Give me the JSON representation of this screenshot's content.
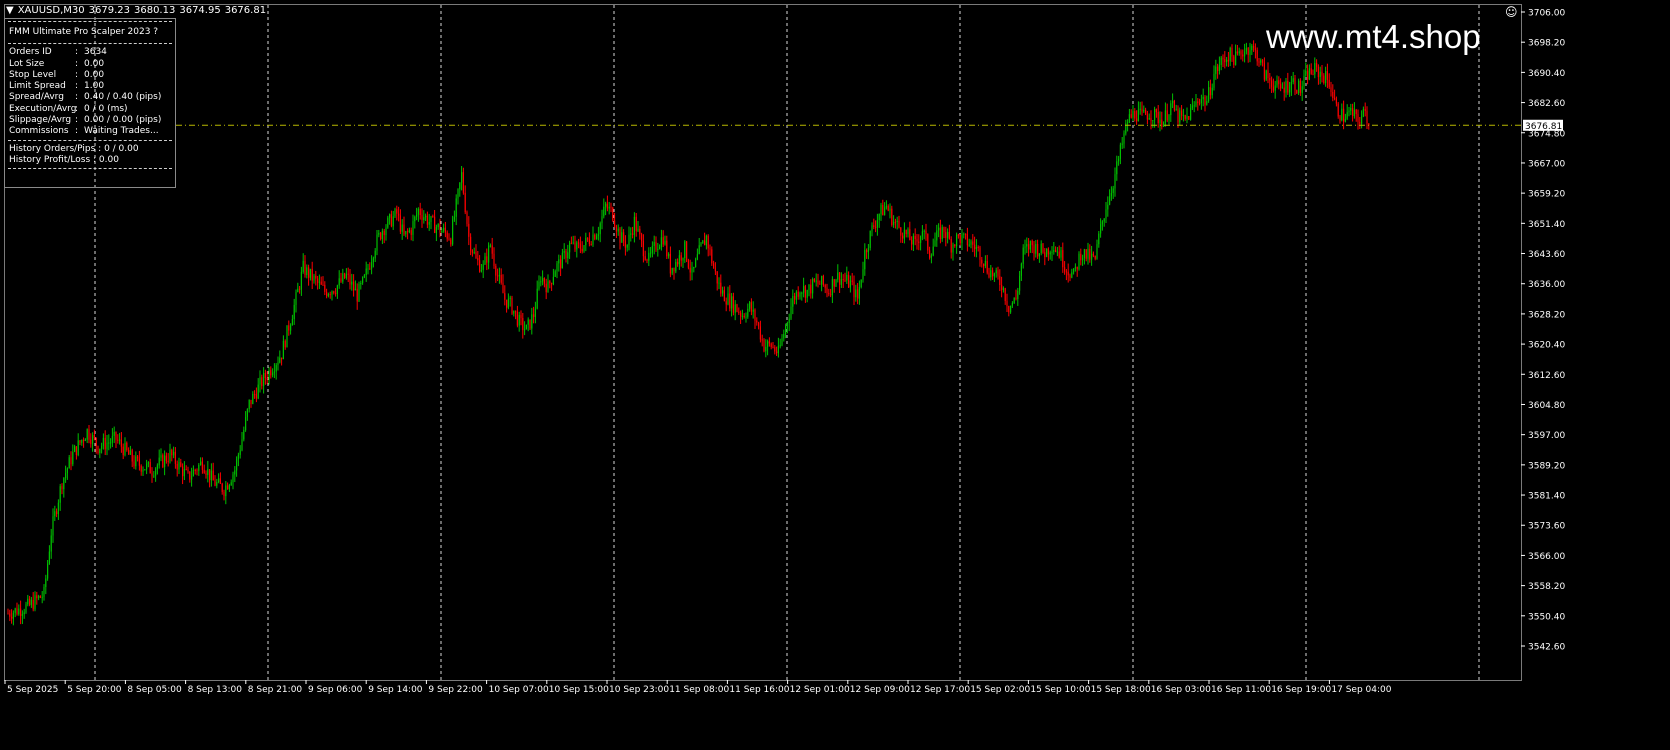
{
  "header": {
    "symbol": "XAUUSD,M30",
    "open": "3679.23",
    "high": "3680.13",
    "low": "3674.95",
    "close": "3676.81",
    "menu_icon": "triangle-down-icon"
  },
  "panel": {
    "title": "FMM Ultimate Pro Scalper 2023  ?",
    "rows": [
      {
        "label": "Orders ID",
        "sep": ":",
        "value": "3634"
      },
      {
        "label": "Lot Size",
        "sep": ":",
        "value": "0.00"
      },
      {
        "label": "Stop Level",
        "sep": ":",
        "value": "0.00"
      },
      {
        "label": "Limit Spread",
        "sep": ":",
        "value": "1.00"
      },
      {
        "label": "Spread/Avrg",
        "sep": ":",
        "value": "0.40 / 0.40 (pips)"
      },
      {
        "label": "Execution/Avrg",
        "sep": ":",
        "value": "0 / 0 (ms)"
      },
      {
        "label": "Slippage/Avrg",
        "sep": ":",
        "value": "0.00 / 0.00 (pips)"
      },
      {
        "label": "Commissions",
        "sep": ":",
        "value": "Waiting Trades..."
      }
    ],
    "history_orders": "History Orders/Pips : 0 / 0.00",
    "history_profit": "History Profit/Loss   :  0.00"
  },
  "watermark": "www.mt4.shop",
  "smiley_icon": "smiley-face-icon",
  "colors": {
    "background": "#000000",
    "bull": "#00c000",
    "bear": "#ff0000",
    "grid": "#ffffff",
    "price_line": "#b8b800",
    "axis": "#ffffff"
  },
  "chart_data": {
    "type": "candlestick",
    "symbol": "XAUUSD",
    "timeframe": "M30",
    "ylim": [
      3542.6,
      3706.0
    ],
    "y_ticks": [
      "3706.00",
      "3698.20",
      "3690.40",
      "3682.60",
      "3674.80",
      "3667.00",
      "3659.20",
      "3651.40",
      "3643.60",
      "3636.00",
      "3628.20",
      "3620.40",
      "3612.60",
      "3604.80",
      "3597.00",
      "3589.20",
      "3581.40",
      "3573.60",
      "3566.00",
      "3558.20",
      "3550.40",
      "3542.60"
    ],
    "x_ticks": [
      "5 Sep 2025",
      "5 Sep 20:00",
      "8 Sep 05:00",
      "8 Sep 13:00",
      "8 Sep 21:00",
      "9 Sep 06:00",
      "9 Sep 14:00",
      "9 Sep 22:00",
      "10 Sep 07:00",
      "10 Sep 15:00",
      "10 Sep 23:00",
      "11 Sep 08:00",
      "11 Sep 16:00",
      "12 Sep 01:00",
      "12 Sep 09:00",
      "12 Sep 17:00",
      "15 Sep 02:00",
      "15 Sep 10:00",
      "15 Sep 18:00",
      "16 Sep 03:00",
      "16 Sep 11:00",
      "16 Sep 19:00",
      "17 Sep 04:00"
    ],
    "current_price_label": "3676.81",
    "current_price": 3676.81,
    "grid": "vertical-dashed",
    "close_path": [
      [
        0,
        3551
      ],
      [
        12,
        3553
      ],
      [
        20,
        3556
      ],
      [
        24,
        3572
      ],
      [
        30,
        3585
      ],
      [
        36,
        3592
      ],
      [
        44,
        3598
      ],
      [
        50,
        3594
      ],
      [
        60,
        3596
      ],
      [
        70,
        3590
      ],
      [
        80,
        3588
      ],
      [
        90,
        3592
      ],
      [
        100,
        3586
      ],
      [
        108,
        3590
      ],
      [
        114,
        3585
      ],
      [
        120,
        3583
      ],
      [
        126,
        3588
      ],
      [
        130,
        3596
      ],
      [
        134,
        3605
      ],
      [
        140,
        3610
      ],
      [
        146,
        3614
      ],
      [
        152,
        3618
      ],
      [
        156,
        3625
      ],
      [
        160,
        3632
      ],
      [
        164,
        3640
      ],
      [
        168,
        3638
      ],
      [
        172,
        3636
      ],
      [
        176,
        3634
      ],
      [
        182,
        3635
      ],
      [
        188,
        3638
      ],
      [
        194,
        3633
      ],
      [
        198,
        3637
      ],
      [
        204,
        3646
      ],
      [
        208,
        3650
      ],
      [
        212,
        3652
      ],
      [
        216,
        3654
      ],
      [
        220,
        3648
      ],
      [
        224,
        3650
      ],
      [
        228,
        3655
      ],
      [
        234,
        3652
      ],
      [
        240,
        3650
      ],
      [
        246,
        3648
      ],
      [
        252,
        3664
      ],
      [
        256,
        3648
      ],
      [
        260,
        3642
      ],
      [
        264,
        3640
      ],
      [
        268,
        3646
      ],
      [
        272,
        3638
      ],
      [
        276,
        3632
      ],
      [
        280,
        3630
      ],
      [
        284,
        3626
      ],
      [
        288,
        3624
      ],
      [
        292,
        3628
      ],
      [
        296,
        3638
      ],
      [
        300,
        3635
      ],
      [
        304,
        3640
      ],
      [
        308,
        3642
      ],
      [
        312,
        3646
      ],
      [
        316,
        3645
      ],
      [
        320,
        3646
      ],
      [
        324,
        3648
      ],
      [
        328,
        3650
      ],
      [
        332,
        3656
      ],
      [
        336,
        3654
      ],
      [
        340,
        3648
      ],
      [
        344,
        3646
      ],
      [
        348,
        3652
      ],
      [
        352,
        3646
      ],
      [
        356,
        3642
      ],
      [
        360,
        3646
      ],
      [
        364,
        3648
      ],
      [
        368,
        3640
      ],
      [
        372,
        3642
      ],
      [
        376,
        3645
      ],
      [
        380,
        3638
      ],
      [
        384,
        3644
      ],
      [
        388,
        3648
      ],
      [
        392,
        3640
      ],
      [
        396,
        3634
      ],
      [
        400,
        3632
      ],
      [
        404,
        3630
      ],
      [
        408,
        3628
      ],
      [
        412,
        3630
      ],
      [
        416,
        3626
      ],
      [
        420,
        3620
      ],
      [
        424,
        3620
      ],
      [
        428,
        3618
      ],
      [
        432,
        3625
      ],
      [
        436,
        3632
      ],
      [
        440,
        3635
      ],
      [
        444,
        3634
      ],
      [
        448,
        3636
      ],
      [
        452,
        3636
      ],
      [
        456,
        3634
      ],
      [
        460,
        3638
      ],
      [
        464,
        3637
      ],
      [
        468,
        3636
      ],
      [
        472,
        3632
      ],
      [
        476,
        3644
      ],
      [
        480,
        3650
      ],
      [
        484,
        3654
      ],
      [
        488,
        3656
      ],
      [
        492,
        3652
      ],
      [
        496,
        3650
      ],
      [
        500,
        3648
      ],
      [
        504,
        3646
      ],
      [
        508,
        3650
      ],
      [
        512,
        3644
      ],
      [
        516,
        3648
      ],
      [
        520,
        3650
      ],
      [
        524,
        3646
      ],
      [
        528,
        3648
      ],
      [
        532,
        3647
      ],
      [
        536,
        3646
      ],
      [
        540,
        3644
      ],
      [
        544,
        3640
      ],
      [
        548,
        3638
      ],
      [
        552,
        3636
      ],
      [
        556,
        3630
      ],
      [
        560,
        3632
      ],
      [
        564,
        3644
      ],
      [
        568,
        3646
      ],
      [
        572,
        3645
      ],
      [
        576,
        3644
      ],
      [
        580,
        3646
      ],
      [
        584,
        3644
      ],
      [
        588,
        3640
      ],
      [
        592,
        3638
      ],
      [
        596,
        3644
      ],
      [
        600,
        3643
      ],
      [
        604,
        3642
      ],
      [
        606,
        3648
      ],
      [
        610,
        3656
      ],
      [
        614,
        3662
      ],
      [
        618,
        3670
      ],
      [
        622,
        3678
      ],
      [
        626,
        3680
      ],
      [
        630,
        3679
      ],
      [
        634,
        3680
      ],
      [
        638,
        3679
      ],
      [
        642,
        3678
      ],
      [
        646,
        3682
      ],
      [
        650,
        3679
      ],
      [
        654,
        3678
      ],
      [
        658,
        3681
      ],
      [
        662,
        3684
      ],
      [
        666,
        3683
      ],
      [
        670,
        3690
      ],
      [
        674,
        3693
      ],
      [
        678,
        3695
      ],
      [
        682,
        3694
      ],
      [
        686,
        3696
      ],
      [
        690,
        3697
      ],
      [
        694,
        3695
      ],
      [
        698,
        3690
      ],
      [
        702,
        3688
      ],
      [
        706,
        3686
      ],
      [
        710,
        3687
      ],
      [
        714,
        3688
      ],
      [
        718,
        3686
      ],
      [
        722,
        3690
      ],
      [
        726,
        3691
      ],
      [
        730,
        3690
      ],
      [
        734,
        3688
      ],
      [
        738,
        3681
      ],
      [
        742,
        3679
      ],
      [
        746,
        3680
      ],
      [
        750,
        3678
      ],
      [
        754,
        3680
      ],
      [
        756,
        3676.81
      ]
    ]
  }
}
